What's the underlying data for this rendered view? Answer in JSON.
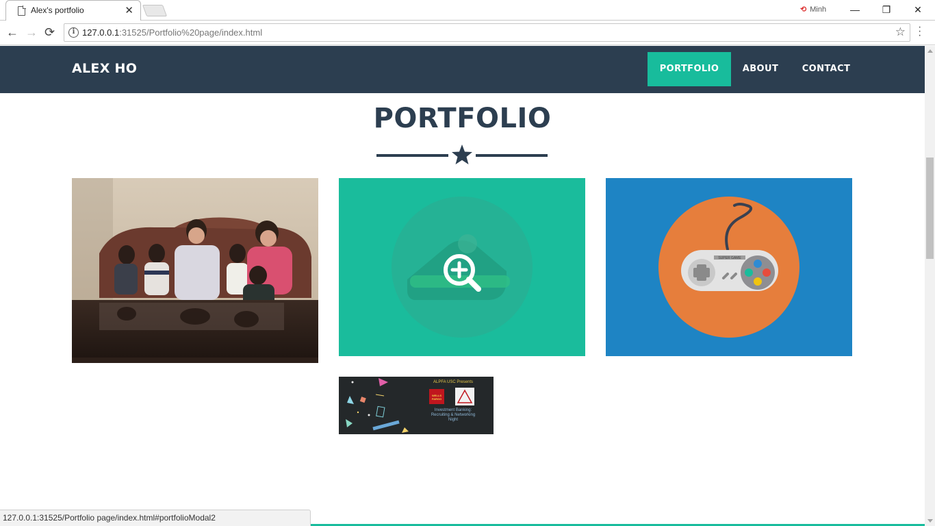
{
  "browser": {
    "tab_title": "Alex's portfolio",
    "tab_close": "✕",
    "profile_name": "Minh",
    "url_host": "127.0.0.1",
    "url_rest": ":31525/Portfolio%20page/index.html",
    "status_url": "127.0.0.1:31525/Portfolio page/index.html#portfolioModal2",
    "win_minimize": "—",
    "win_restore": "❐",
    "win_close": "✕",
    "back": "←",
    "forward": "→",
    "reload": "⟳",
    "bookmark": "☆"
  },
  "navbar": {
    "brand": "ALEX HO",
    "items": [
      {
        "label": "PORTFOLIO",
        "active": true
      },
      {
        "label": "ABOUT",
        "active": false
      },
      {
        "label": "CONTACT",
        "active": false
      }
    ]
  },
  "portfolio": {
    "title": "PORTFOLIO",
    "divider_icon": "star-icon",
    "items": [
      {
        "kind": "family-photo",
        "icon": "photo"
      },
      {
        "kind": "zoom-hover",
        "icon": "magnifier-plus-icon"
      },
      {
        "kind": "game-controller",
        "icon": "gamepad-icon"
      },
      {
        "kind": "event-flyer",
        "icon": "flyer"
      }
    ],
    "flyer": {
      "presenter": "ALPFA USC Presents",
      "logo1": "WELLS FARGO",
      "headline1": "Investment Banking:",
      "headline2": "Recruiting & Networking",
      "headline3": "Night"
    },
    "controller_brand": "SUPER GAME"
  },
  "colors": {
    "navbar_bg": "#2c3e50",
    "accent": "#18bc9c",
    "tile_teal": "#1abc9c",
    "tile_blue": "#1e84c4",
    "controller_circle": "#e67e3c"
  }
}
